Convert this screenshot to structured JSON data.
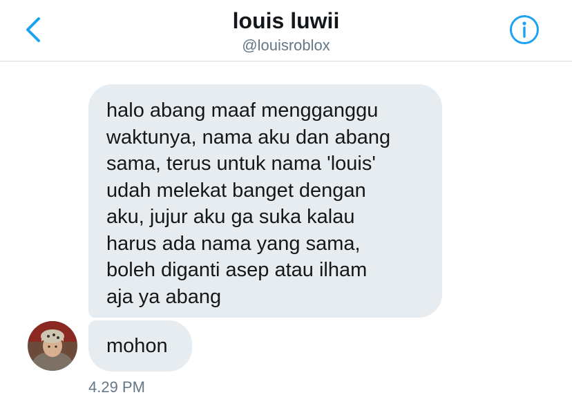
{
  "header": {
    "title": "louis luwii",
    "handle": "@louisroblox",
    "back_icon": "chevron-left-icon",
    "info_icon": "info-icon",
    "accent_color": "#1da1f2"
  },
  "messages": [
    {
      "text": "halo abang maaf mengganggu\nwaktunya, nama aku dan abang\nsama, terus untuk nama 'louis'\nudah melekat banget dengan\naku, jujur aku ga suka kalau\nharus ada nama yang sama,\nboleh diganti asep atau ilham\naja ya abang"
    },
    {
      "text": "mohon"
    }
  ],
  "timestamp": "4.29 PM",
  "colors": {
    "bubble_bg": "#e6ecf0",
    "text": "#14171a",
    "secondary_text": "#657786"
  }
}
